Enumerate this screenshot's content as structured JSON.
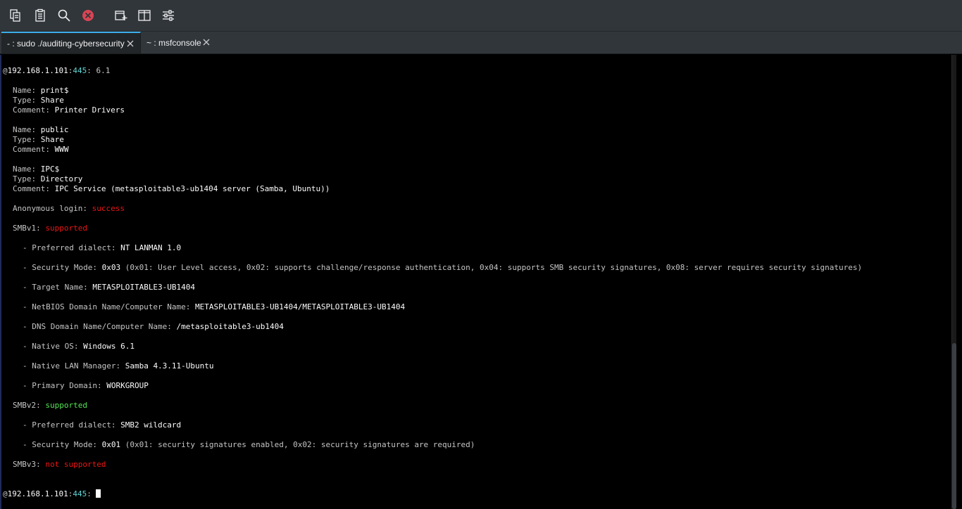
{
  "toolbar": {
    "buttons": [
      {
        "name": "copy-icon"
      },
      {
        "name": "paste-icon"
      },
      {
        "name": "search-icon"
      },
      {
        "name": "stop-icon"
      },
      {
        "name": "new-tab-icon"
      },
      {
        "name": "split-view-icon"
      },
      {
        "name": "settings-sliders-icon"
      }
    ]
  },
  "tabs": [
    {
      "label": "- : sudo ./auditing-cybersecurity",
      "active": true
    },
    {
      "label": "~ : msfconsole",
      "active": false
    }
  ],
  "terminal": {
    "header": {
      "at": "@",
      "host": "192.168.1.101",
      "port_sep": ":",
      "port": "445",
      "sep": ":",
      "version": " 6.1"
    },
    "shares": [
      {
        "name_label": "Name: ",
        "name": "print$",
        "type_label": "Type: ",
        "type": "Share",
        "comment_label": "Comment: ",
        "comment": "Printer Drivers"
      },
      {
        "name_label": "Name: ",
        "name": "public",
        "type_label": "Type: ",
        "type": "Share",
        "comment_label": "Comment: ",
        "comment": "WWW"
      },
      {
        "name_label": "Name: ",
        "name": "IPC$",
        "type_label": "Type: ",
        "type": "Directory",
        "comment_label": "Comment: ",
        "comment": "IPC Service (metasploitable3-ub1404 server (Samba, Ubuntu))"
      }
    ],
    "anon": {
      "label": "Anonymous login: ",
      "value": "success"
    },
    "smbv1": {
      "label": "SMBv1: ",
      "value": "supported",
      "details": [
        {
          "label": "- Preferred dialect: ",
          "value": "NT LANMAN 1.0",
          "extra": ""
        },
        {
          "label": "- Security Mode: ",
          "value": "0x03",
          "extra": " (0x01: User Level access, 0x02: supports challenge/response authentication, 0x04: supports SMB security signatures, 0x08: server requires security signatures)"
        },
        {
          "label": "- Target Name: ",
          "value": "METASPLOITABLE3-UB1404",
          "extra": ""
        },
        {
          "label": "- NetBIOS Domain Name/Computer Name: ",
          "value": "METASPLOITABLE3-UB1404/METASPLOITABLE3-UB1404",
          "extra": ""
        },
        {
          "label": "- DNS Domain Name/Computer Name: ",
          "value": "/metasploitable3-ub1404",
          "extra": ""
        },
        {
          "label": "- Native OS: ",
          "value": "Windows 6.1",
          "extra": ""
        },
        {
          "label": "- Native LAN Manager: ",
          "value": "Samba 4.3.11-Ubuntu",
          "extra": ""
        },
        {
          "label": "- Primary Domain: ",
          "value": "WORKGROUP",
          "extra": ""
        }
      ]
    },
    "smbv2": {
      "label": "SMBv2: ",
      "value": "supported",
      "details": [
        {
          "label": "- Preferred dialect: ",
          "value": "SMB2 wildcard",
          "extra": ""
        },
        {
          "label": "- Security Mode: ",
          "value": "0x01",
          "extra": " (0x01: security signatures enabled, 0x02: security signatures are required)"
        }
      ]
    },
    "smbv3": {
      "label": "SMBv3: ",
      "value": "not supported"
    },
    "prompt": {
      "at": "@",
      "host": "192.168.1.101",
      "port_sep": ":",
      "port": "445",
      "sep": ": "
    }
  }
}
